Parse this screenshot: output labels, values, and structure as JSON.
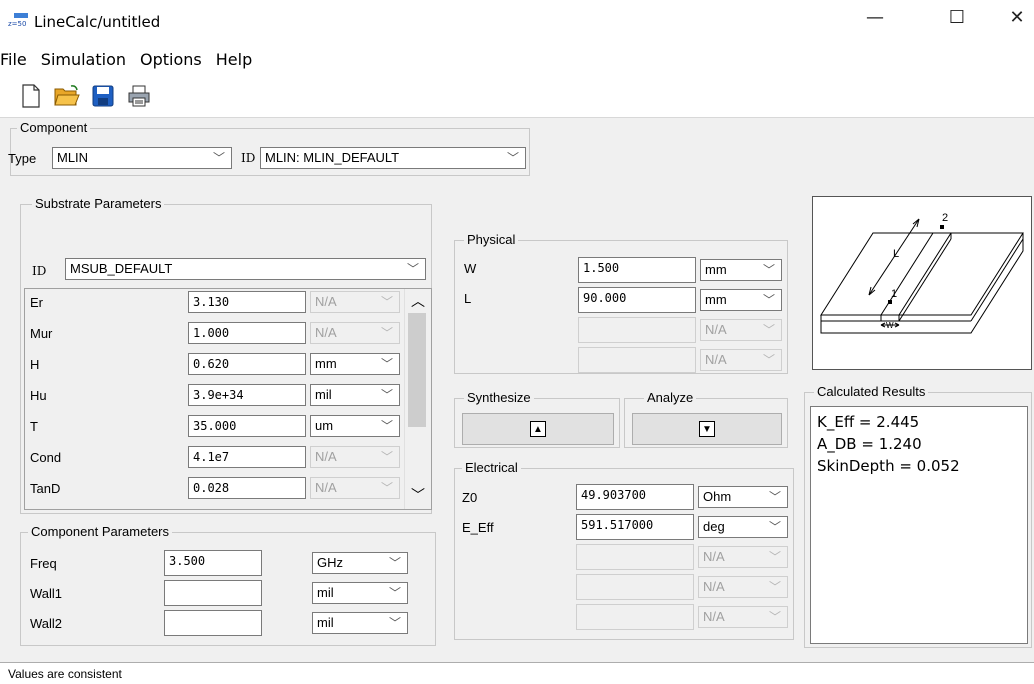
{
  "window": {
    "title": "LineCalc/untitled",
    "app_icon_text": "z=50",
    "controls": {
      "minimize": "—",
      "maximize": "☐",
      "close": "✕"
    }
  },
  "menu": [
    "File",
    "Simulation",
    "Options",
    "Help"
  ],
  "toolbar": [
    "new-icon",
    "open-icon",
    "save-icon",
    "print-icon"
  ],
  "component": {
    "group_label": "Component",
    "type_label": "Type",
    "type_value": "MLIN",
    "id_label": "ID",
    "id_value": "MLIN: MLIN_DEFAULT"
  },
  "substrate": {
    "group_label": "Substrate Parameters",
    "id_label": "ID",
    "id_value": "MSUB_DEFAULT",
    "rows": [
      {
        "name": "Er",
        "value": "3.130",
        "unit": "N/A",
        "unit_disabled": true
      },
      {
        "name": "Mur",
        "value": "1.000",
        "unit": "N/A",
        "unit_disabled": true
      },
      {
        "name": "H",
        "value": "0.620",
        "unit": "mm",
        "unit_disabled": false
      },
      {
        "name": "Hu",
        "value": "3.9e+34",
        "unit": "mil",
        "unit_disabled": false
      },
      {
        "name": "T",
        "value": "35.000",
        "unit": "um",
        "unit_disabled": false
      },
      {
        "name": "Cond",
        "value": "4.1e7",
        "unit": "N/A",
        "unit_disabled": true
      },
      {
        "name": "TanD",
        "value": "0.028",
        "unit": "N/A",
        "unit_disabled": true
      }
    ]
  },
  "component_params": {
    "group_label": "Component Parameters",
    "rows": [
      {
        "name": "Freq",
        "value": "3.500",
        "unit": "GHz"
      },
      {
        "name": "Wall1",
        "value": "",
        "unit": "mil"
      },
      {
        "name": "Wall2",
        "value": "",
        "unit": "mil"
      }
    ]
  },
  "physical": {
    "group_label": "Physical",
    "rows": [
      {
        "name": "W",
        "value": "1.500",
        "unit": "mm",
        "disabled": false
      },
      {
        "name": "L",
        "value": "90.000",
        "unit": "mm",
        "disabled": false
      },
      {
        "name": "",
        "value": "",
        "unit": "N/A",
        "disabled": true
      },
      {
        "name": "",
        "value": "",
        "unit": "N/A",
        "disabled": true
      }
    ]
  },
  "synthesize": {
    "group_label": "Synthesize",
    "glyph": "▲"
  },
  "analyze": {
    "group_label": "Analyze",
    "glyph": "▼"
  },
  "electrical": {
    "group_label": "Electrical",
    "rows": [
      {
        "name": "Z0",
        "value": "49.903700",
        "unit": "Ohm",
        "disabled": false
      },
      {
        "name": "E_Eff",
        "value": "591.517000",
        "unit": "deg",
        "disabled": false
      },
      {
        "name": "",
        "value": "",
        "unit": "N/A",
        "disabled": true
      },
      {
        "name": "",
        "value": "",
        "unit": "N/A",
        "disabled": true
      },
      {
        "name": "",
        "value": "",
        "unit": "N/A",
        "disabled": true
      }
    ]
  },
  "diagram": {
    "label_2": "2",
    "label_l": "L",
    "label_1": "1",
    "label_w": "W"
  },
  "results": {
    "group_label": "Calculated Results",
    "lines": [
      "K_Eff = 2.445",
      "A_DB = 1.240",
      "SkinDepth = 0.052"
    ]
  },
  "status": "Values are consistent",
  "colors": {
    "window_bg": "#f0f0f0",
    "field_bg": "#ffffff",
    "disabled_text": "#a0a0a0"
  }
}
